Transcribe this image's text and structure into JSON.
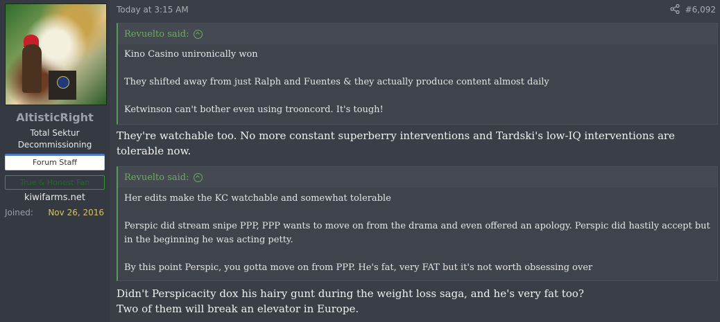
{
  "user": {
    "name": "AltisticRight",
    "title": "Total Sektur Decommissioning",
    "staff_badge": "Forum Staff",
    "fan_badge": "True & Honest Fan",
    "site": "kiwifarms.net",
    "joined_label": "Joined:",
    "joined_value": "Nov 26, 2016"
  },
  "post": {
    "timestamp": "Today at 3:15 AM",
    "number": "#6,092",
    "quotes": [
      {
        "author": "Revuelto said:",
        "lines": [
          "Kino Casino unironically won",
          "They shifted away from just Ralph and Fuentes & they actually produce content almost daily",
          "Ketwinson can't bother even using trooncord. It's tough!"
        ]
      },
      {
        "author": "Revuelto said:",
        "lines": [
          "Her edits make the KC watchable and somewhat tolerable",
          "Perspic did stream snipe PPP, PPP wants to move on from the drama and even offered an apology. Perspic did hastily accept but in the beginning he was acting petty.",
          "By this point Perspic, you gotta move on from PPP. He's fat, very FAT but it's not worth obsessing over"
        ]
      }
    ],
    "replies": [
      "They're watchable too. No more constant superberry interventions and Tardski's low-IQ interventions are tolerable now.",
      "Didn't Perspicacity dox his hairy gunt during the weight loss saga, and he's very fat too?",
      "Two of them will break an elevator in Europe."
    ]
  }
}
